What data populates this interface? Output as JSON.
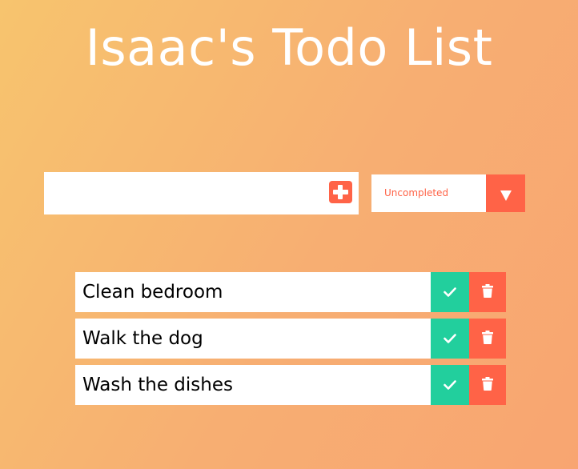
{
  "header": {
    "title": "Isaac's Todo List"
  },
  "new_todo": {
    "value": "",
    "placeholder": "",
    "add_icon": "plus-square-icon"
  },
  "filter": {
    "selected": "Uncompleted",
    "arrow_icon": "triangle-down-icon"
  },
  "todos": [
    {
      "text": "Clean bedroom",
      "completed": false
    },
    {
      "text": "Walk the dog",
      "completed": false
    },
    {
      "text": "Wash the dishes",
      "completed": false
    }
  ],
  "icons": {
    "complete": "check-icon",
    "delete": "trash-icon"
  },
  "colors": {
    "accent": "#ff6347",
    "complete": "#22cf9d",
    "background_start": "#f7c46e",
    "background_end": "#f8a571"
  }
}
